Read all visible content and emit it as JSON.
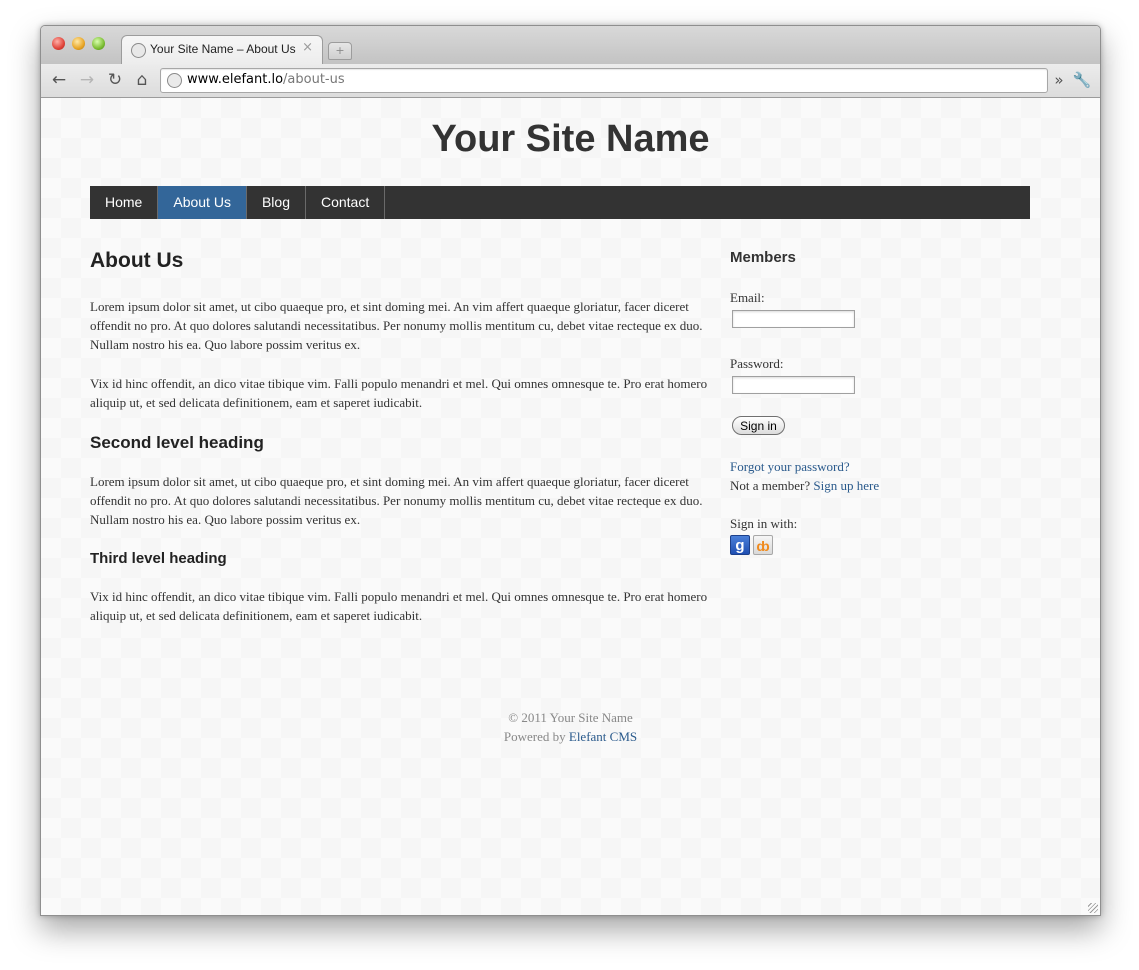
{
  "browser": {
    "tab_title": "Your Site Name – About Us",
    "tab_close": "×",
    "new_tab": "+",
    "url_host": "www.elefant.lo",
    "url_path": "/about-us",
    "back_icon": "←",
    "forward_icon": "→",
    "reload_icon": "↻",
    "home_icon": "⌂",
    "more_icon": "»",
    "wrench_icon": "🔧"
  },
  "site": {
    "title": "Your Site Name"
  },
  "nav": {
    "items": [
      {
        "label": "Home"
      },
      {
        "label": "About Us",
        "active": true
      },
      {
        "label": "Blog"
      },
      {
        "label": "Contact"
      }
    ],
    "bar_color": "#333333",
    "active_color": "#336699"
  },
  "main": {
    "heading": "About Us",
    "p1": "Lorem ipsum dolor sit amet, ut cibo quaeque pro, et sint doming mei. An vim affert quaeque gloriatur, facer diceret offendit no pro. At quo dolores salutandi necessitatibus. Per nonumy mollis mentitum cu, debet vitae recteque ex duo. Nullam nostro his ea. Quo labore possim veritus ex.",
    "p2": "Vix id hinc offendit, an dico vitae tibique vim. Falli populo menandri et mel. Qui omnes omnesque te. Pro erat homero aliquip ut, et sed delicata definitionem, eam et saperet iudicabit.",
    "h2": "Second level heading",
    "p3": "Lorem ipsum dolor sit amet, ut cibo quaeque pro, et sint doming mei. An vim affert quaeque gloriatur, facer diceret offendit no pro. At quo dolores salutandi necessitatibus. Per nonumy mollis mentitum cu, debet vitae recteque ex duo. Nullam nostro his ea. Quo labore possim veritus ex.",
    "h3": "Third level heading",
    "p4": "Vix id hinc offendit, an dico vitae tibique vim. Falli populo menandri et mel. Qui omnes omnesque te. Pro erat homero aliquip ut, et sed delicata definitionem, eam et saperet iudicabit."
  },
  "sidebar": {
    "heading": "Members",
    "email_label": "Email:",
    "email_value": "",
    "password_label": "Password:",
    "password_value": "",
    "signin_button": "Sign in",
    "forgot_link": "Forgot your password?",
    "not_member_text": "Not a member?",
    "signup_link": "Sign up here",
    "signin_with": "Sign in with:",
    "providers": [
      {
        "name": "google",
        "glyph": "g"
      },
      {
        "name": "openid",
        "glyph": "ȸ"
      }
    ]
  },
  "footer": {
    "copyright": "© 2011 Your Site Name",
    "powered_by": "Powered by",
    "cms_link": "Elefant CMS"
  }
}
